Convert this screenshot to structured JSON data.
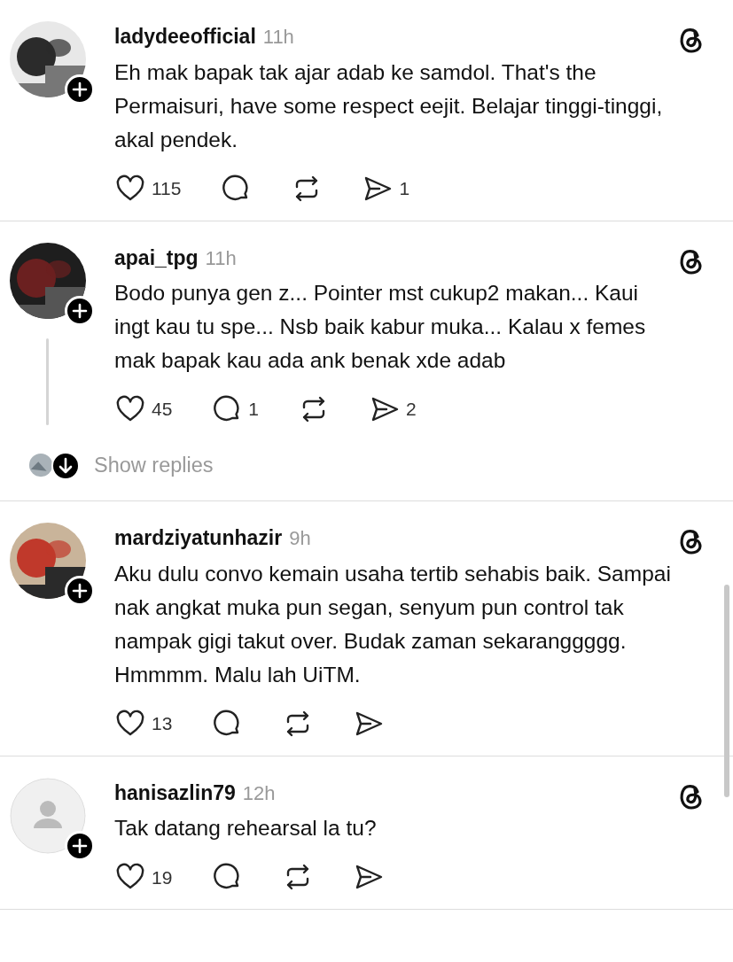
{
  "posts": [
    {
      "username": "ladydeeofficial",
      "time": "11h",
      "text": "Eh mak bapak tak ajar adab ke samdol. That's the Permaisuri, have some respect eejit. Belajar tinggi-tinggi, akal pendek.",
      "likes": "115",
      "shares": "1"
    },
    {
      "username": "apai_tpg",
      "time": "11h",
      "text": "Bodo punya gen z... Pointer mst cukup2 makan... Kaui ingt kau tu spe... Nsb baik kabur muka... Kalau x femes mak bapak kau ada ank benak xde adab",
      "likes": "45",
      "replies": "1",
      "shares": "2",
      "show_replies": "Show replies"
    },
    {
      "username": "mardziyatunhazir",
      "time": "9h",
      "text": "Aku dulu convo kemain usaha tertib sehabis baik. Sampai nak angkat muka pun segan, senyum pun control tak nampak gigi takut over. Budak zaman sekaranggggg. Hmmmm. Malu lah UiTM.",
      "likes": "13"
    },
    {
      "username": "hanisazlin79",
      "time": "12h",
      "avatar": {
        "kind": "default"
      },
      "text": "Tak datang rehearsal la tu?",
      "likes": "19"
    }
  ]
}
